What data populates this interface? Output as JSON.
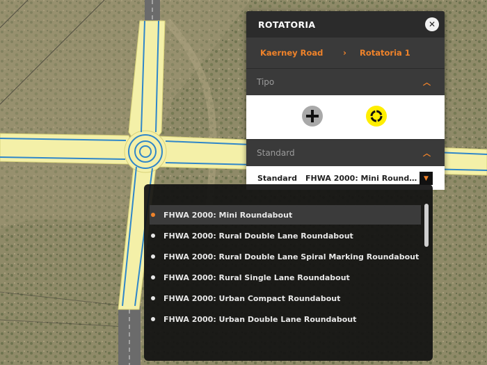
{
  "panel": {
    "title": "ROTATORIA",
    "close_icon": "close-icon",
    "breadcrumb": [
      "Kaerney Road",
      "Rotatoria 1"
    ],
    "breadcrumb_separator": "›"
  },
  "tipo": {
    "label": "Tipo",
    "options": [
      {
        "icon": "intersection-plus-icon"
      },
      {
        "icon": "roundabout-icon",
        "selected": true
      }
    ]
  },
  "standard": {
    "section_label": "Standard",
    "row_label": "Standard",
    "value": "FHWA 2000: Mini Roundab..."
  },
  "dropdown": {
    "options": [
      {
        "label": "FHWA 2000: Mini Roundabout",
        "selected": true
      },
      {
        "label": "FHWA 2000: Rural Double Lane Roundabout"
      },
      {
        "label": "FHWA 2000: Rural Double Lane Spiral Marking Roundabout"
      },
      {
        "label": "FHWA 2000: Rural Single Lane Roundabout"
      },
      {
        "label": "FHWA 2000: Urban Compact Roundabout"
      },
      {
        "label": "FHWA 2000: Urban Double Lane Roundabout"
      }
    ]
  },
  "colors": {
    "accent": "#f0832a",
    "road_buffer": "#f4f0a8",
    "lane_line": "#2f86c9",
    "roundabout_icon": "#ffee00"
  }
}
